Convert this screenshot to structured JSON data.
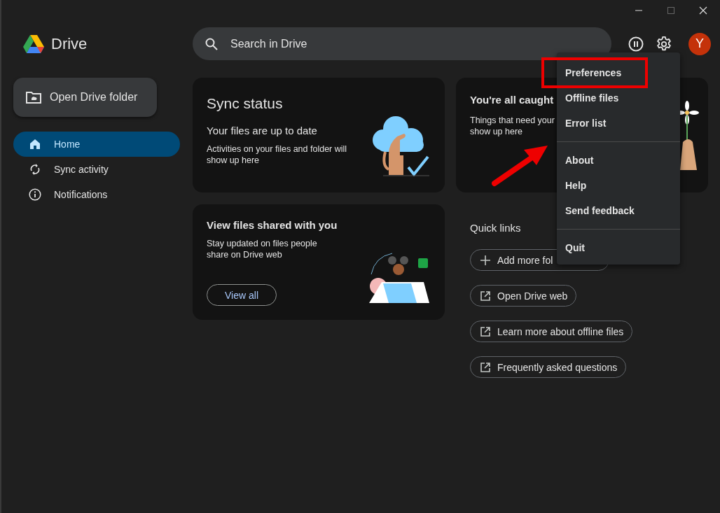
{
  "app": {
    "name": "Drive"
  },
  "search": {
    "placeholder": "Search in Drive"
  },
  "account": {
    "initial": "Y"
  },
  "sidebar": {
    "open_button": "Open Drive folder",
    "items": [
      {
        "label": "Home",
        "kind": "home",
        "selected": true
      },
      {
        "label": "Sync activity",
        "kind": "sync",
        "selected": false
      },
      {
        "label": "Notifications",
        "kind": "info",
        "selected": false
      }
    ]
  },
  "sync_card": {
    "title": "Sync status",
    "heading": "Your files are up to date",
    "text": "Activities on your files and folder will show up here"
  },
  "caught_up_card": {
    "title": "You're all caught",
    "text_lines": [
      "Things that need your",
      "show up here"
    ]
  },
  "shared_card": {
    "title": "View files shared with you",
    "text": "Stay updated on files people share on Drive web",
    "button": "View all"
  },
  "quick_links": {
    "title": "Quick links",
    "links": [
      {
        "label": "Add more fol",
        "kind": "add"
      },
      {
        "label": "Open Drive web",
        "kind": "external"
      },
      {
        "label": "Learn more about offline files",
        "kind": "external"
      },
      {
        "label": "Frequently asked questions",
        "kind": "external"
      }
    ]
  },
  "settings_menu": {
    "groups": [
      [
        {
          "label": "Preferences",
          "highlighted": true
        },
        {
          "label": "Offline files",
          "highlighted": false
        },
        {
          "label": "Error list",
          "highlighted": false
        }
      ],
      [
        {
          "label": "About",
          "highlighted": false
        },
        {
          "label": "Help",
          "highlighted": false
        },
        {
          "label": "Send feedback",
          "highlighted": false
        }
      ],
      [
        {
          "label": "Quit",
          "highlighted": false
        }
      ]
    ]
  }
}
